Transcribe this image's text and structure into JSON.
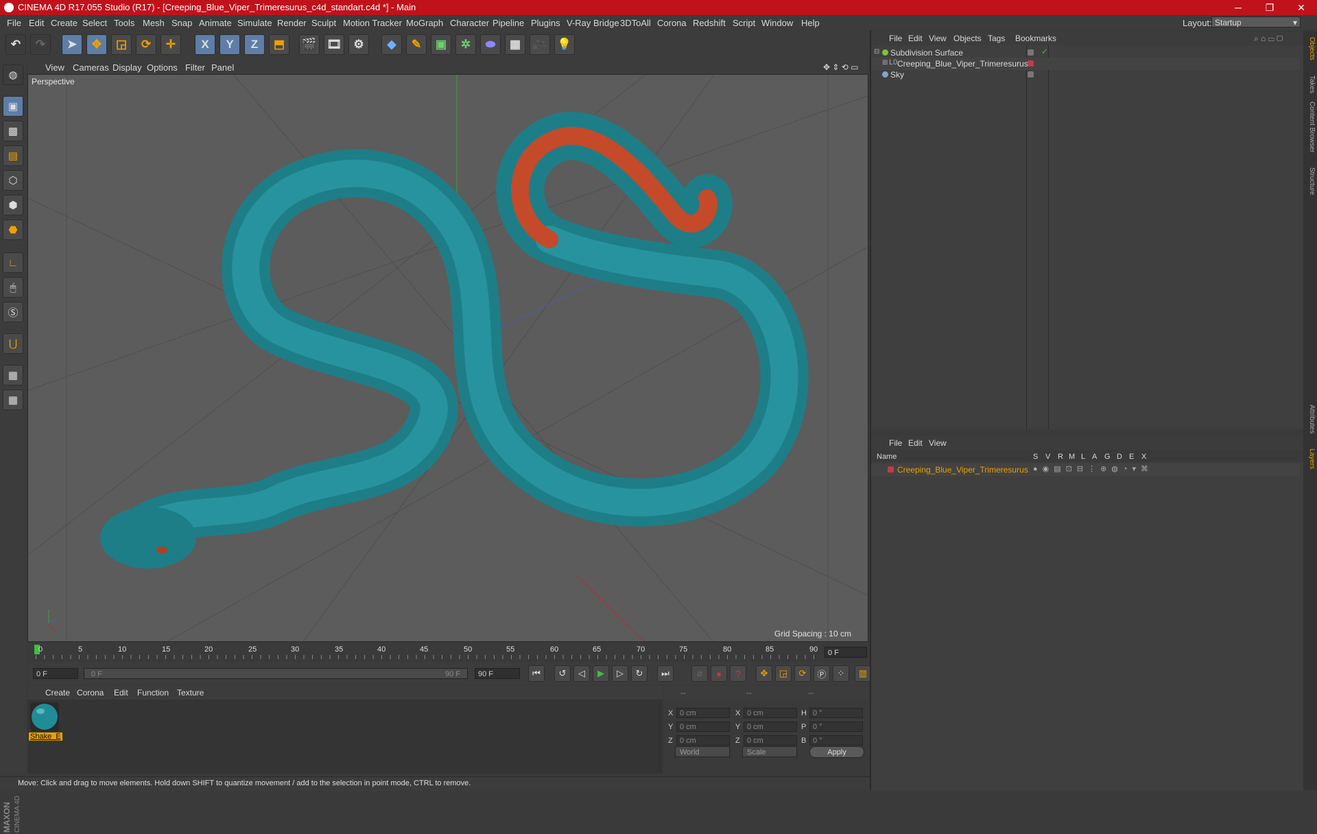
{
  "titlebar": {
    "title": "CINEMA 4D R17.055 Studio (R17) - [Creeping_Blue_Viper_Trimeresurus_c4d_standart.c4d *] - Main",
    "minimize": "─",
    "maximize": "❐",
    "close": "✕"
  },
  "menubar": {
    "items": [
      "File",
      "Edit",
      "Create",
      "Select",
      "Tools",
      "Mesh",
      "Snap",
      "Animate",
      "Simulate",
      "Render",
      "Sculpt",
      "Motion Tracker",
      "MoGraph",
      "Character",
      "Pipeline",
      "Plugins",
      "V-Ray Bridge",
      "3DToAll",
      "Corona",
      "Redshift",
      "Script",
      "Window",
      "Help"
    ],
    "layout_label": "Layout:",
    "layout_value": "Startup"
  },
  "toolbar": {
    "axis_x": "X",
    "axis_y": "Y",
    "axis_z": "Z"
  },
  "viewport": {
    "menu": [
      "View",
      "Cameras",
      "Display",
      "Options",
      "Filter",
      "Panel"
    ],
    "label": "Perspective",
    "grid_spacing": "Grid Spacing : 10 cm"
  },
  "timeline": {
    "ticks": [
      "0",
      "5",
      "10",
      "15",
      "20",
      "25",
      "30",
      "35",
      "40",
      "45",
      "50",
      "55",
      "60",
      "65",
      "70",
      "75",
      "80",
      "85",
      "90"
    ],
    "current_frame": "0 F",
    "start_field": "0 F",
    "range_start": "0 F",
    "range_end": "90 F",
    "end_field": "90 F"
  },
  "material_manager": {
    "menu": [
      "Create",
      "Corona",
      "Edit",
      "Function",
      "Texture"
    ],
    "material_name": "Shake_E"
  },
  "coordinates": {
    "header": [
      "--",
      "--",
      "--"
    ],
    "rows": [
      {
        "l1": "X",
        "v1": "0 cm",
        "l2": "X",
        "v2": "0 cm",
        "l3": "H",
        "v3": "0 °"
      },
      {
        "l1": "Y",
        "v1": "0 cm",
        "l2": "Y",
        "v2": "0 cm",
        "l3": "P",
        "v3": "0 °"
      },
      {
        "l1": "Z",
        "v1": "0 cm",
        "l2": "Z",
        "v2": "0 cm",
        "l3": "B",
        "v3": "0 °"
      }
    ],
    "space": "World",
    "mode": "Scale",
    "apply": "Apply"
  },
  "status": "Move: Click and drag to move elements. Hold down SHIFT to quantize movement / add to the selection in point mode, CTRL to remove.",
  "object_manager": {
    "menu": [
      "File",
      "Edit",
      "View",
      "Objects",
      "Tags",
      "Bookmarks"
    ],
    "objects": [
      {
        "name": "Subdivision Surface",
        "color": "#7fbf3f"
      },
      {
        "name": "Creeping_Blue_Viper_Trimeresurus",
        "color": "#c23a4a"
      },
      {
        "name": "Sky",
        "color": "#8aa0c8"
      }
    ]
  },
  "layer_manager": {
    "menu": [
      "File",
      "Edit",
      "View"
    ],
    "columns": [
      "Name",
      "S",
      "V",
      "R",
      "M",
      "L",
      "A",
      "G",
      "D",
      "E",
      "X"
    ],
    "layers": [
      {
        "name": "Creeping_Blue_Viper_Trimeresurus",
        "color": "#c23a4a"
      }
    ]
  },
  "side_tabs": [
    "Objects",
    "Takes",
    "Content Browser",
    "Structure",
    "Attributes",
    "Layers"
  ],
  "brand": "MAXON CINEMA 4D",
  "colors": {
    "accent": "#c0121b",
    "selected_text": "#e8a000",
    "snake_body": "#1f8c96",
    "snake_tail": "#c44a2a"
  }
}
